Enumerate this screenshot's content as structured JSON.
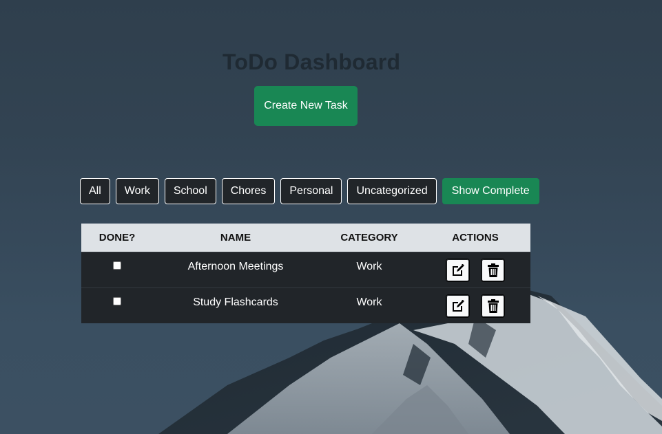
{
  "page": {
    "title": "ToDo Dashboard",
    "create_button_label": "Create New Task"
  },
  "filters": [
    {
      "label": "All"
    },
    {
      "label": "Work"
    },
    {
      "label": "School"
    },
    {
      "label": "Chores"
    },
    {
      "label": "Personal"
    },
    {
      "label": "Uncategorized"
    },
    {
      "label": "Show Complete"
    }
  ],
  "table": {
    "headers": {
      "done": "DONE?",
      "name": "NAME",
      "category": "CATEGORY",
      "actions": "ACTIONS"
    },
    "rows": [
      {
        "done": false,
        "name": "Afternoon Meetings",
        "category": "Work",
        "edit_icon": "edit-icon",
        "delete_icon": "trash-icon"
      },
      {
        "done": false,
        "name": "Study Flashcards",
        "category": "Work",
        "edit_icon": "edit-icon",
        "delete_icon": "trash-icon"
      }
    ]
  },
  "colors": {
    "accent_green": "#198754",
    "dark_button": "#212529",
    "table_header_bg": "#dee2e6",
    "table_row_bg": "#212529"
  }
}
